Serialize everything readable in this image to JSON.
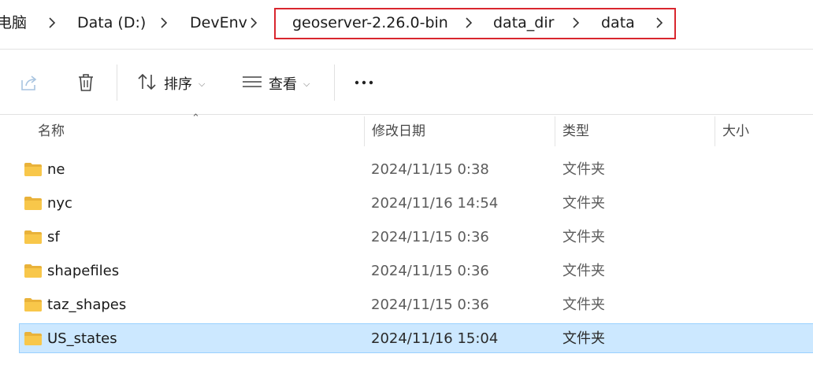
{
  "breadcrumb": {
    "items": [
      "电脑",
      "Data (D:)",
      "DevEnv",
      "geoserver-2.26.0-bin",
      "data_dir",
      "data"
    ]
  },
  "toolbar": {
    "share_icon": "share-icon",
    "delete_icon": "trash-icon",
    "sort_label": "排序",
    "view_label": "查看",
    "more_label": "···"
  },
  "columns": {
    "name": "名称",
    "date": "修改日期",
    "type": "类型",
    "size": "大小"
  },
  "files": [
    {
      "name": "ne",
      "date": "2024/11/15 0:38",
      "type": "文件夹"
    },
    {
      "name": "nyc",
      "date": "2024/11/16 14:54",
      "type": "文件夹"
    },
    {
      "name": "sf",
      "date": "2024/11/15 0:36",
      "type": "文件夹"
    },
    {
      "name": "shapefiles",
      "date": "2024/11/15 0:36",
      "type": "文件夹"
    },
    {
      "name": "taz_shapes",
      "date": "2024/11/15 0:36",
      "type": "文件夹"
    },
    {
      "name": "US_states",
      "date": "2024/11/16 15:04",
      "type": "文件夹",
      "selected": true
    }
  ],
  "colors": {
    "selection_bg": "#cce8ff",
    "selection_border": "#99d1ff",
    "highlight_box": "#d9262e",
    "folder": "#f8c74a"
  }
}
